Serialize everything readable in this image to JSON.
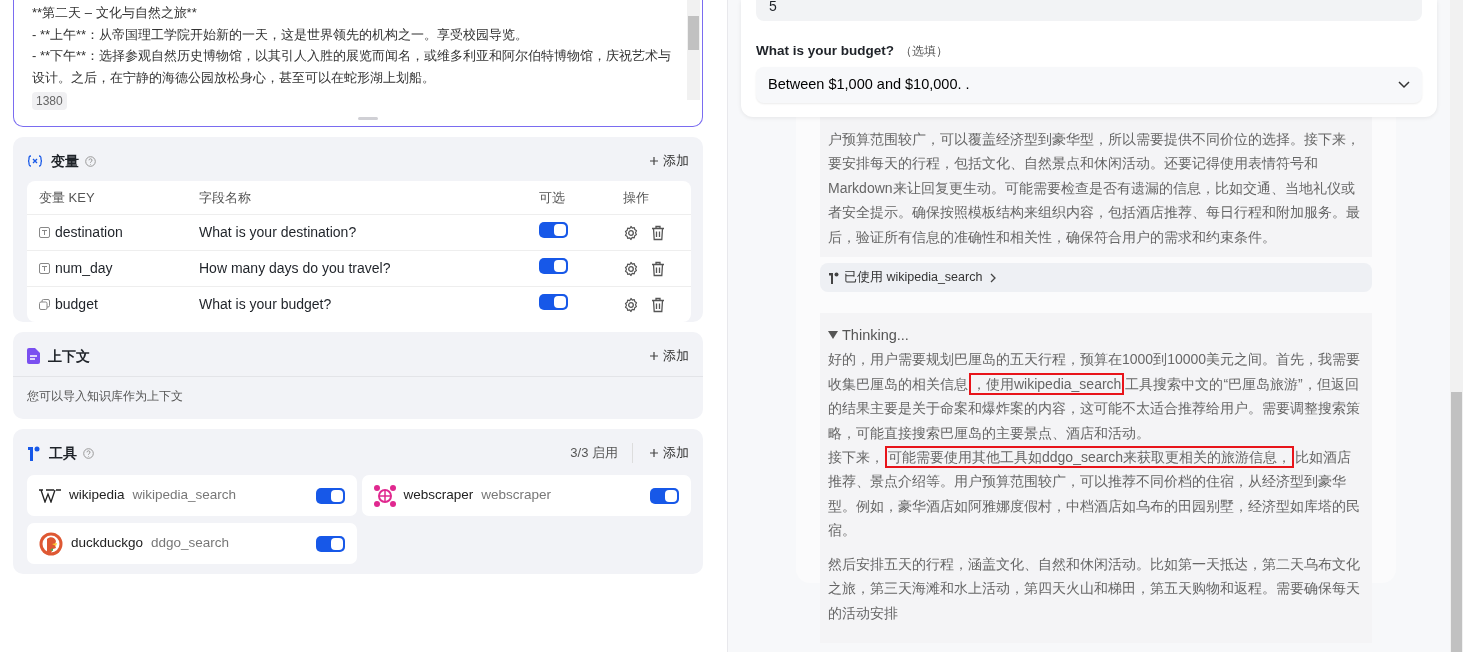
{
  "editor": {
    "lines": [
      "**第二天 – 文化与自然之旅**",
      "- **上午**：从帝国理工学院开始新的一天，这是世界领先的机构之一。享受校园导览。",
      "- **下午**：选择参观自然历史博物馆，以其引人入胜的展览而闻名，或维多利亚和阿尔伯特博物馆，庆祝艺术与设计。之后，在宁静的海德公园放松身心，甚至可以在蛇形湖上划船。"
    ],
    "count": "1380"
  },
  "variables": {
    "title": "变量",
    "add": "添加",
    "columns": [
      "变量 KEY",
      "字段名称",
      "可选",
      "操作"
    ],
    "rows": [
      {
        "kind": "text",
        "key": "destination",
        "label": "What is your destination?",
        "optional": true
      },
      {
        "kind": "text",
        "key": "num_day",
        "label": "How many days do you travel?",
        "optional": true
      },
      {
        "kind": "select",
        "key": "budget",
        "label": "What is your budget?",
        "optional": true
      }
    ]
  },
  "context": {
    "title": "上下文",
    "add": "添加",
    "hint": "您可以导入知识库作为上下文"
  },
  "tools": {
    "title": "工具",
    "count": "3/3 启用",
    "add": "添加",
    "items": [
      {
        "kind": "wikipedia",
        "name": "wikipedia",
        "id": "wikipedia_search",
        "enabled": true
      },
      {
        "kind": "webscraper",
        "name": "webscraper",
        "id": "webscraper",
        "enabled": true
      },
      {
        "kind": "duckduckgo",
        "name": "duckduckgo",
        "id": "ddgo_search",
        "enabled": true
      }
    ]
  },
  "form": {
    "prev_value": "5",
    "label": "What is your budget?",
    "optional_note": "（选填）",
    "value": "Between $1,000 and $10,000. ."
  },
  "chat": {
    "thinking_prev": "户预算范围较广，可以覆盖经济型到豪华型，所以需要提供不同价位的选择。接下来，要安排每天的行程，包括文化、自然景点和休闲活动。还要记得使用表情符号和Markdown来让回复更生动。可能需要检查是否有遗漏的信息，比如交通、当地礼仪或者安全提示。确保按照模板结构来组织内容，包括酒店推荐、每日行程和附加服务。最后，验证所有信息的准确性和相关性，确保符合用户的需求和约束条件。",
    "tool_used": "已使用 wikipedia_search",
    "thinking": {
      "title": "Thinking...",
      "expanded": true,
      "paragraphs": [
        [
          {
            "text": "好的，用户需要规划巴厘岛的五天行程，预算在1000到10000美元之间。首先，我需要收集巴厘岛的相关信息",
            "highlighted": false
          },
          {
            "text": "，使用wikipedia_search",
            "highlighted": true
          },
          {
            "text": "工具搜索中文的“巴厘岛旅游”，但返回的结果主要是关于命案和爆炸案的内容，这可能不太适合推荐给用户。需要调整搜索策略，可能直接搜索巴厘岛的主要景点、酒店和活动。",
            "highlighted": false
          }
        ],
        [
          {
            "text": "接下来，",
            "highlighted": false
          },
          {
            "text": "可能需要使用其他工具如ddgo_search来获取更相关的旅游信息，",
            "highlighted": true
          },
          {
            "text": "比如酒店推荐、景点介绍等。用户预算范围较广，可以推荐不同价档的住宿，从经济型到豪华型。例如，豪华酒店如阿雅娜度假村，中档酒店如乌布的田园别墅，经济型如库塔的民宿。",
            "highlighted": false
          }
        ],
        [
          {
            "text": "然后安排五天的行程，涵盖文化、自然和休闲活动。比如第一天抵达，第二天乌布文化之旅，第三天海滩和水上活动，第四天火山和梯田，第五天购物和返程。需要确保每天的活动安排",
            "highlighted": false
          }
        ]
      ]
    }
  }
}
